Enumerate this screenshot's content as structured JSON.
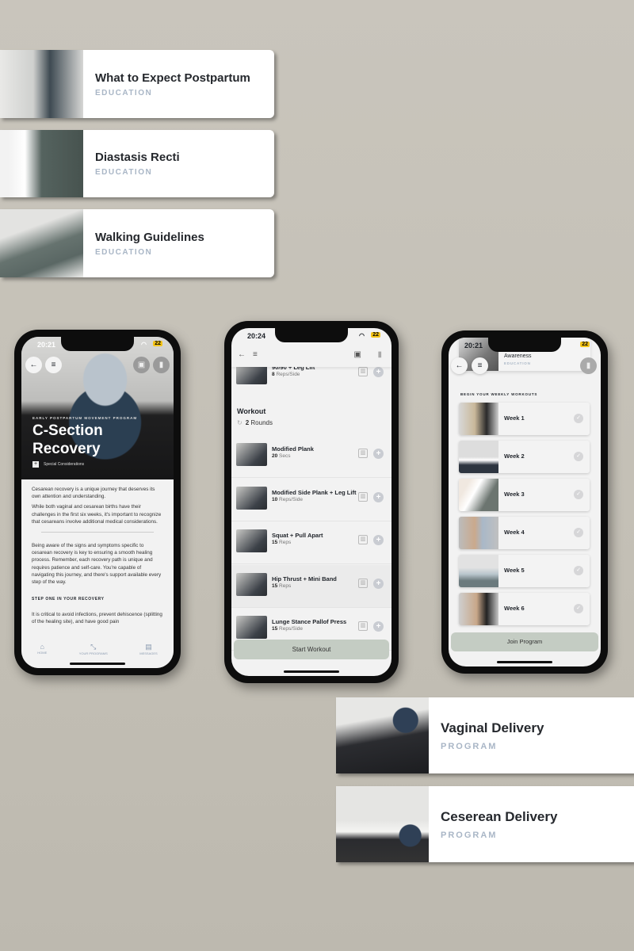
{
  "education_cards": [
    {
      "title": "What to Expect Postpartum",
      "tag": "EDUCATION"
    },
    {
      "title": "Diastasis Recti",
      "tag": "EDUCATION"
    },
    {
      "title": "Walking Guidelines",
      "tag": "EDUCATION"
    }
  ],
  "program_cards": [
    {
      "title": "Vaginal Delivery",
      "tag": "PROGRAM"
    },
    {
      "title": "Ceserean Delivery",
      "tag": "PROGRAM"
    }
  ],
  "phone1": {
    "time": "20:21",
    "battery": "22",
    "eyebrow": "EARLY POSTPARTUM MOVEMENT PROGRAM",
    "title": "C-Section Recovery",
    "badge": "Special Considerations",
    "paragraphs": [
      "Cesarean recovery is a unique journey that deserves its own attention and understanding.",
      "While both vaginal and cesarean births have their challenges in the first six weeks, it's important to recognize that cesareans involve additional medical considerations.",
      "Being aware of the signs and symptoms specific to cesarean recovery is key to ensuring a smooth healing process. Remember, each recovery path is unique and requires patience and self-care. You're capable of navigating this journey, and there's support available every step of the way."
    ],
    "section_heading": "STEP ONE IN YOUR RECOVERY",
    "section_text": "It is critical to avoid infections, prevent dehiscence (splitting of the healing site), and have good pain",
    "tabs": [
      {
        "label": "HOME",
        "icon": "home-icon"
      },
      {
        "label": "YOUR PROGRAMS",
        "icon": "programs-icon"
      },
      {
        "label": "MESSAGES",
        "icon": "messages-icon"
      }
    ]
  },
  "phone2": {
    "time": "20:24",
    "battery": "22",
    "top_exercise": {
      "name": "90/90 + Leg Lift",
      "count": "8",
      "unit": "Reps/Side"
    },
    "section_title": "Workout",
    "rounds_count": "2",
    "rounds_label": "Rounds",
    "exercises": [
      {
        "name": "Modified Plank",
        "count": "20",
        "unit": "Secs"
      },
      {
        "name": "Modified Side Plank + Leg Lift",
        "count": "10",
        "unit": "Reps/Side"
      },
      {
        "name": "Squat + Pull Apart",
        "count": "15",
        "unit": "Reps"
      },
      {
        "name": "Hip Thrust + Mini Band",
        "count": "15",
        "unit": "Reps"
      },
      {
        "name": "Lunge Stance Pallof Press",
        "count": "15",
        "unit": "Reps/Side"
      }
    ],
    "button": "Start Workout"
  },
  "phone3": {
    "time": "20:21",
    "battery": "22",
    "top_item": {
      "title": "Awareness",
      "tag": "EDUCATION"
    },
    "section_heading": "BEGIN YOUR WEEKLY WORKOUTS",
    "weeks": [
      "Week 1",
      "Week 2",
      "Week 3",
      "Week 4",
      "Week 5",
      "Week 6"
    ],
    "button": "Join Program"
  },
  "colors": {
    "background": "#c6c2b9",
    "tag": "#a9b6c6",
    "button": "#c4ccc3"
  }
}
